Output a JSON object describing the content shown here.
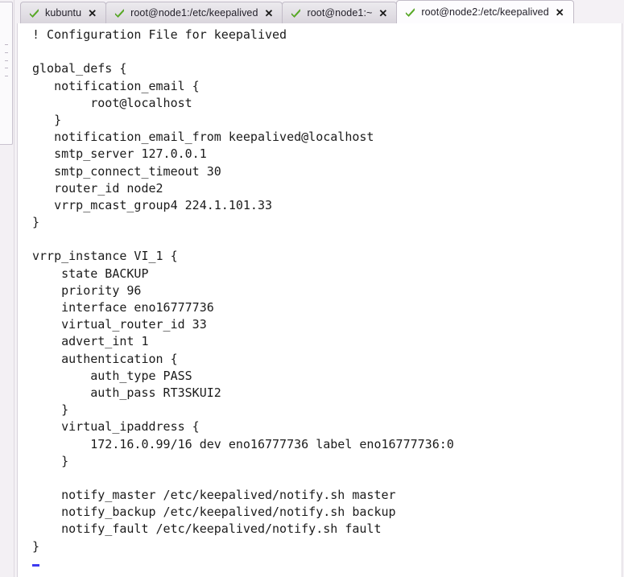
{
  "window": {
    "app_kind": "terminal-emulator",
    "accent_check_color": "#5cb524",
    "tab_active_bg": "#fdfcfe",
    "tab_inactive_bg": "#e3e0e6",
    "terminal_bg": "#ffffff",
    "terminal_fg": "#1b1b1b",
    "cursor_color": "#3d3af0"
  },
  "tabs": [
    {
      "label": "kubuntu",
      "icon": "check-icon",
      "close_icon": "✕",
      "active": false
    },
    {
      "label": "root@node1:/etc/keepalived",
      "icon": "check-icon",
      "close_icon": "✕",
      "active": false
    },
    {
      "label": "root@node1:~",
      "icon": "check-icon",
      "close_icon": "✕",
      "active": false
    },
    {
      "label": "root@node2:/etc/keepalived",
      "icon": "check-icon",
      "close_icon": "✕",
      "active": true
    }
  ],
  "terminal": {
    "title": "root@node2:/etc/keepalived",
    "cursor_visible": true,
    "lines": [
      "! Configuration File for keepalived",
      "",
      "global_defs {",
      "   notification_email {",
      "        root@localhost",
      "   }",
      "   notification_email_from keepalived@localhost",
      "   smtp_server 127.0.0.1",
      "   smtp_connect_timeout 30",
      "   router_id node2",
      "   vrrp_mcast_group4 224.1.101.33",
      "}",
      "",
      "vrrp_instance VI_1 {",
      "    state BACKUP",
      "    priority 96",
      "    interface eno16777736",
      "    virtual_router_id 33",
      "    advert_int 1",
      "    authentication {",
      "        auth_type PASS",
      "        auth_pass RT3SKUI2",
      "    }",
      "    virtual_ipaddress {",
      "        172.16.0.99/16 dev eno16777736 label eno16777736:0",
      "    }",
      "",
      "    notify_master /etc/keepalived/notify.sh master",
      "    notify_backup /etc/keepalived/notify.sh backup",
      "    notify_fault /etc/keepalived/notify.sh fault",
      "}"
    ]
  },
  "side_panel": {
    "name": "collapsed-side-panel",
    "handle": "drag-handle"
  }
}
